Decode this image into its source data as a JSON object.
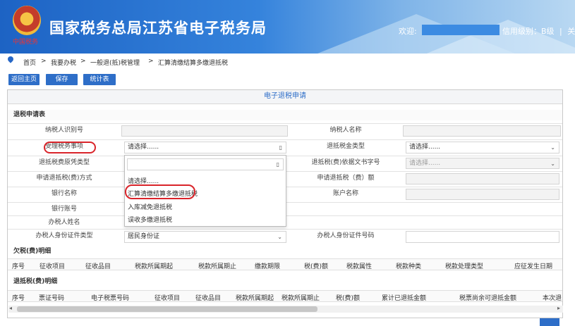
{
  "header": {
    "title": "国家税务总局江苏省电子税务局",
    "logo_text": "中国税务",
    "welcome": "欢迎:",
    "credit": "信用级别：B级",
    "separator": "|",
    "logout": "关闭当"
  },
  "breadcrumb": [
    "首页",
    "我要办税",
    "一般退(抵)税管理",
    "汇算清缴结算多缴退抵税"
  ],
  "breadcrumb_sep": ">",
  "toolbar": {
    "home": "返回主页",
    "save": "保存",
    "stats": "统计表"
  },
  "form": {
    "panel_title": "电子退税申请",
    "section_refund": "退税申请表",
    "taxpayer_id_label": "纳税人识别号",
    "taxpayer_name_label": "纳税人名称",
    "matter_label": "受理税务事项",
    "matter_value": "请选择......",
    "refund_type_label": "退抵税金类型",
    "refund_type_value": "请选择......",
    "voucher_type_label": "退抵税费原凭类型",
    "doc_no_label": "退抵税(费)依据文书字号",
    "doc_no_value": "请选择......",
    "method_label": "申请退抵税(费)方式",
    "amount_label": "申请退抵税（费）额",
    "bank_name_label": "银行名称",
    "account_name_label": "账户名称",
    "bank_account_label": "银行账号",
    "agent_name_label": "办税人姓名",
    "agent_id_type_label": "办税人身份证件类型",
    "agent_id_type_value": "居民身份证",
    "agent_id_no_label": "办税人身份证件号码"
  },
  "dropdown": {
    "options": [
      "请选择......",
      "汇算清缴结算多缴退抵税",
      "入库减免退抵税",
      "误收多缴退抵税"
    ]
  },
  "arrears": {
    "title": "欠税(费)明细",
    "columns": [
      "序号",
      "征收项目",
      "征收品目",
      "税款所属期起",
      "税款所属期止",
      "缴款期限",
      "税(费)额",
      "税款属性",
      "税款种类",
      "税款处理类型",
      "应征发生日期"
    ]
  },
  "refund_detail": {
    "title": "退抵税(费)明细",
    "columns": [
      "序号",
      "票证号码",
      "电子税票号码",
      "征收项目",
      "征收品目",
      "税款所属期起",
      "税款所属期止",
      "税(费)额",
      "累计已退抵金额",
      "税票尚余可退抵金额",
      "本次退"
    ]
  },
  "icons": {
    "pin": "location-pin-icon",
    "arrow": "chevron-down-icon"
  }
}
